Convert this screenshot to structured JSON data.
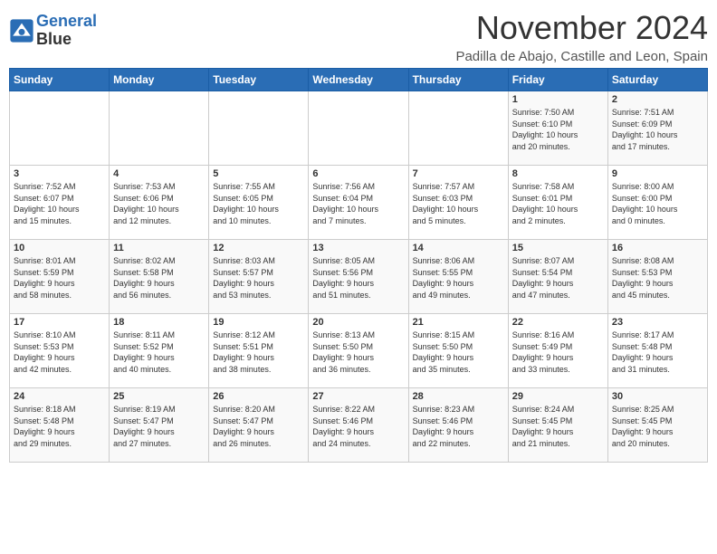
{
  "header": {
    "logo_line1": "General",
    "logo_line2": "Blue",
    "month": "November 2024",
    "location": "Padilla de Abajo, Castille and Leon, Spain"
  },
  "days_of_week": [
    "Sunday",
    "Monday",
    "Tuesday",
    "Wednesday",
    "Thursday",
    "Friday",
    "Saturday"
  ],
  "weeks": [
    [
      {
        "day": "",
        "info": ""
      },
      {
        "day": "",
        "info": ""
      },
      {
        "day": "",
        "info": ""
      },
      {
        "day": "",
        "info": ""
      },
      {
        "day": "",
        "info": ""
      },
      {
        "day": "1",
        "info": "Sunrise: 7:50 AM\nSunset: 6:10 PM\nDaylight: 10 hours\nand 20 minutes."
      },
      {
        "day": "2",
        "info": "Sunrise: 7:51 AM\nSunset: 6:09 PM\nDaylight: 10 hours\nand 17 minutes."
      }
    ],
    [
      {
        "day": "3",
        "info": "Sunrise: 7:52 AM\nSunset: 6:07 PM\nDaylight: 10 hours\nand 15 minutes."
      },
      {
        "day": "4",
        "info": "Sunrise: 7:53 AM\nSunset: 6:06 PM\nDaylight: 10 hours\nand 12 minutes."
      },
      {
        "day": "5",
        "info": "Sunrise: 7:55 AM\nSunset: 6:05 PM\nDaylight: 10 hours\nand 10 minutes."
      },
      {
        "day": "6",
        "info": "Sunrise: 7:56 AM\nSunset: 6:04 PM\nDaylight: 10 hours\nand 7 minutes."
      },
      {
        "day": "7",
        "info": "Sunrise: 7:57 AM\nSunset: 6:03 PM\nDaylight: 10 hours\nand 5 minutes."
      },
      {
        "day": "8",
        "info": "Sunrise: 7:58 AM\nSunset: 6:01 PM\nDaylight: 10 hours\nand 2 minutes."
      },
      {
        "day": "9",
        "info": "Sunrise: 8:00 AM\nSunset: 6:00 PM\nDaylight: 10 hours\nand 0 minutes."
      }
    ],
    [
      {
        "day": "10",
        "info": "Sunrise: 8:01 AM\nSunset: 5:59 PM\nDaylight: 9 hours\nand 58 minutes."
      },
      {
        "day": "11",
        "info": "Sunrise: 8:02 AM\nSunset: 5:58 PM\nDaylight: 9 hours\nand 56 minutes."
      },
      {
        "day": "12",
        "info": "Sunrise: 8:03 AM\nSunset: 5:57 PM\nDaylight: 9 hours\nand 53 minutes."
      },
      {
        "day": "13",
        "info": "Sunrise: 8:05 AM\nSunset: 5:56 PM\nDaylight: 9 hours\nand 51 minutes."
      },
      {
        "day": "14",
        "info": "Sunrise: 8:06 AM\nSunset: 5:55 PM\nDaylight: 9 hours\nand 49 minutes."
      },
      {
        "day": "15",
        "info": "Sunrise: 8:07 AM\nSunset: 5:54 PM\nDaylight: 9 hours\nand 47 minutes."
      },
      {
        "day": "16",
        "info": "Sunrise: 8:08 AM\nSunset: 5:53 PM\nDaylight: 9 hours\nand 45 minutes."
      }
    ],
    [
      {
        "day": "17",
        "info": "Sunrise: 8:10 AM\nSunset: 5:53 PM\nDaylight: 9 hours\nand 42 minutes."
      },
      {
        "day": "18",
        "info": "Sunrise: 8:11 AM\nSunset: 5:52 PM\nDaylight: 9 hours\nand 40 minutes."
      },
      {
        "day": "19",
        "info": "Sunrise: 8:12 AM\nSunset: 5:51 PM\nDaylight: 9 hours\nand 38 minutes."
      },
      {
        "day": "20",
        "info": "Sunrise: 8:13 AM\nSunset: 5:50 PM\nDaylight: 9 hours\nand 36 minutes."
      },
      {
        "day": "21",
        "info": "Sunrise: 8:15 AM\nSunset: 5:50 PM\nDaylight: 9 hours\nand 35 minutes."
      },
      {
        "day": "22",
        "info": "Sunrise: 8:16 AM\nSunset: 5:49 PM\nDaylight: 9 hours\nand 33 minutes."
      },
      {
        "day": "23",
        "info": "Sunrise: 8:17 AM\nSunset: 5:48 PM\nDaylight: 9 hours\nand 31 minutes."
      }
    ],
    [
      {
        "day": "24",
        "info": "Sunrise: 8:18 AM\nSunset: 5:48 PM\nDaylight: 9 hours\nand 29 minutes."
      },
      {
        "day": "25",
        "info": "Sunrise: 8:19 AM\nSunset: 5:47 PM\nDaylight: 9 hours\nand 27 minutes."
      },
      {
        "day": "26",
        "info": "Sunrise: 8:20 AM\nSunset: 5:47 PM\nDaylight: 9 hours\nand 26 minutes."
      },
      {
        "day": "27",
        "info": "Sunrise: 8:22 AM\nSunset: 5:46 PM\nDaylight: 9 hours\nand 24 minutes."
      },
      {
        "day": "28",
        "info": "Sunrise: 8:23 AM\nSunset: 5:46 PM\nDaylight: 9 hours\nand 22 minutes."
      },
      {
        "day": "29",
        "info": "Sunrise: 8:24 AM\nSunset: 5:45 PM\nDaylight: 9 hours\nand 21 minutes."
      },
      {
        "day": "30",
        "info": "Sunrise: 8:25 AM\nSunset: 5:45 PM\nDaylight: 9 hours\nand 20 minutes."
      }
    ]
  ]
}
